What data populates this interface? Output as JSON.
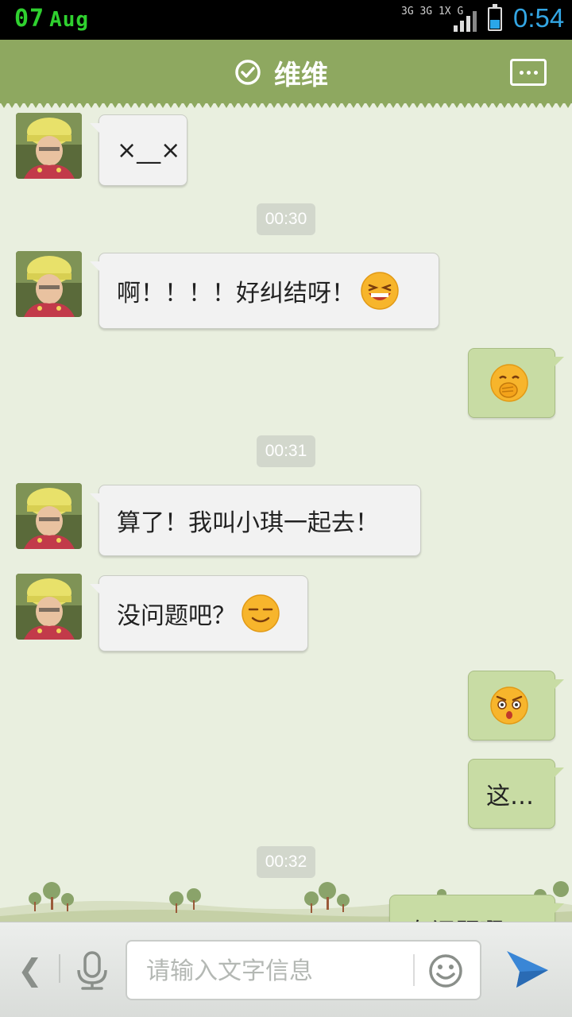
{
  "status_bar": {
    "date_day": "07",
    "date_month": "Aug",
    "network_labels": [
      "3G",
      "3G",
      "1X",
      "G"
    ],
    "time": "0:54",
    "battery_color": "#2aa7ea"
  },
  "header": {
    "contact_name": "维维",
    "verified_icon": "check-circle-icon",
    "menu_icon": "more-dots-icon",
    "bar_color": "#8ea860"
  },
  "messages": [
    {
      "type": "incoming",
      "text": "×__×",
      "emoji": null
    },
    {
      "type": "timestamp",
      "text": "00:30"
    },
    {
      "type": "incoming",
      "text": "啊！！！！好纠结呀！",
      "emoji": "laughing-squint-emoji"
    },
    {
      "type": "outgoing",
      "text": "",
      "emoji": "hand-over-mouth-emoji"
    },
    {
      "type": "timestamp",
      "text": "00:31"
    },
    {
      "type": "incoming",
      "text": "算了！我叫小琪一起去！",
      "emoji": null
    },
    {
      "type": "incoming",
      "text": "没问题吧？",
      "emoji": "content-smile-emoji"
    },
    {
      "type": "outgoing",
      "text": "",
      "emoji": "shocked-angry-emoji"
    },
    {
      "type": "outgoing",
      "text": "这…",
      "emoji": null
    },
    {
      "type": "timestamp",
      "text": "00:32"
    },
    {
      "type": "outgoing",
      "text": "有问题啊！",
      "emoji": null
    }
  ],
  "input_bar": {
    "placeholder": "请输入文字信息",
    "value": "",
    "back_glyph": "❮"
  }
}
